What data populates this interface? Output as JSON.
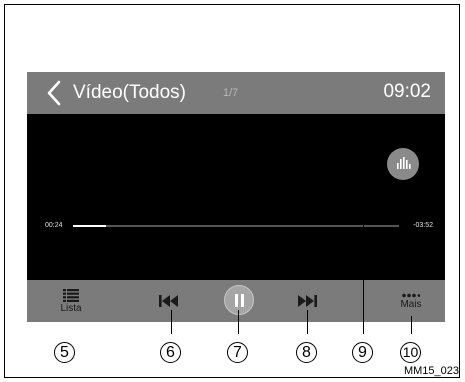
{
  "header": {
    "title": "Vídeo(Todos)",
    "pager": "1/7",
    "clock": "09:02"
  },
  "player": {
    "elapsed": "00:24",
    "remaining": "-03:52",
    "progress_fraction": 0.1
  },
  "controls": {
    "list_label": "Lista",
    "more_label": "Mais",
    "list_icon": "list-icon",
    "prev_icon": "skip-previous-icon",
    "pause_icon": "pause-icon",
    "next_icon": "skip-next-icon",
    "more_icon": "dots-icon",
    "eq_icon": "equalizer-icon"
  },
  "callouts": [
    "5",
    "6",
    "7",
    "8",
    "9",
    "10"
  ],
  "figure_code": "MM15_023",
  "colors": {
    "bar_gray": "#7b7b7b",
    "screen_black": "#000000",
    "text_white": "#ffffff"
  }
}
